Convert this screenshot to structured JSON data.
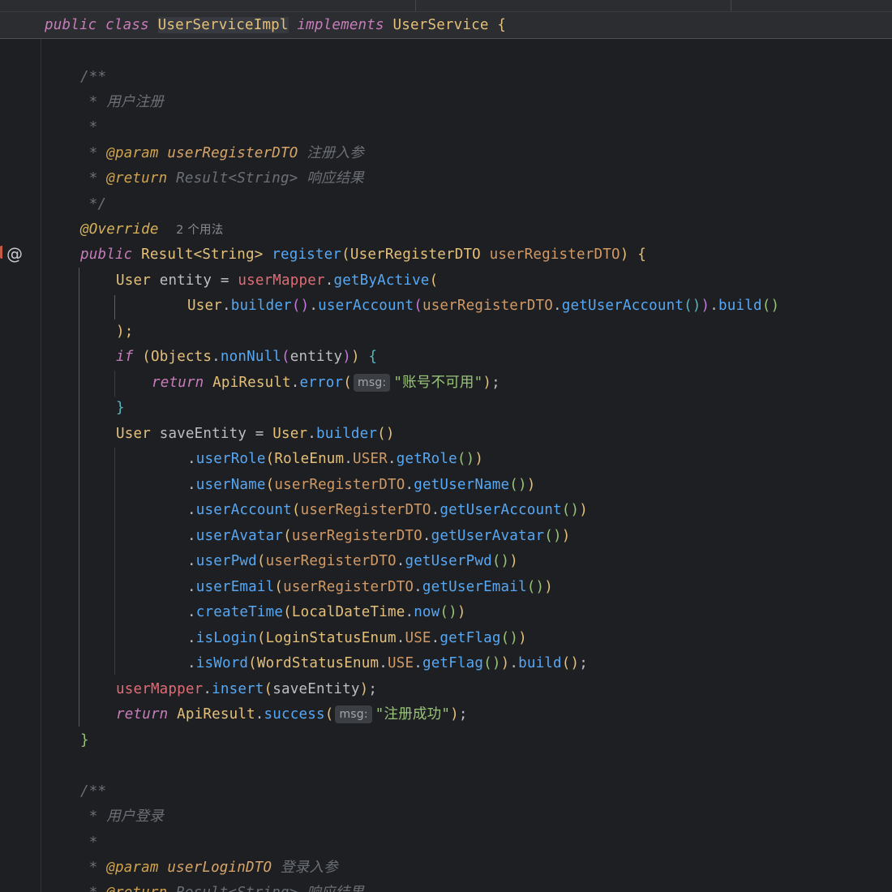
{
  "editor": {
    "header": {
      "kw_public": "public",
      "kw_class": "class",
      "class_name": "UserServiceImpl",
      "kw_implements": "implements",
      "interface_name": "UserService",
      "brace": "{"
    },
    "gutter": {
      "implementation_marker": "@"
    },
    "doc1": {
      "open": "/**",
      "summary": " * 用户注册",
      "blank": " *",
      "param_star": " * ",
      "param_tag": "@param",
      "param_name": "userRegisterDTO",
      "param_desc": "注册入参",
      "return_star": " * ",
      "return_tag": "@return",
      "return_type": "Result<String>",
      "return_desc": "响应结果",
      "close": " */"
    },
    "override": {
      "annotation": "@Override",
      "usages_hint": "2 个用法"
    },
    "method_sig": {
      "kw_public": "public",
      "return_type": "Result<String>",
      "name": "register",
      "param_type": "UserRegisterDTO",
      "param_name": "userRegisterDTO",
      "tail": ") {"
    },
    "stmt_entity": {
      "type": "User",
      "var": "entity",
      "eq": " = ",
      "field": "userMapper",
      "method": "getByActive",
      "open": "("
    },
    "stmt_builder_line": {
      "type": "User",
      "builder": "builder",
      "userAccount": "userAccount",
      "dto": "userRegisterDTO",
      "getter": "getUserAccount",
      "build": "build"
    },
    "stmt_close": ");",
    "if_line": {
      "kw_if": "if",
      "cls": "Objects",
      "method": "nonNull",
      "arg": "entity"
    },
    "return_error": {
      "kw_return": "return",
      "cls": "ApiResult",
      "method": "error",
      "hint": "msg:",
      "string": "\"账号不可用\""
    },
    "close_if": "}",
    "save_entity": {
      "type": "User",
      "var": "saveEntity",
      "eq": " = ",
      "cls": "User",
      "method": "builder"
    },
    "chain": [
      {
        "method": "userRole",
        "arg_cls": "RoleEnum",
        "arg_const": "USER",
        "arg_call": "getRole",
        "style": "enum"
      },
      {
        "method": "userName",
        "arg_cls": "userRegisterDTO",
        "arg_call": "getUserName",
        "style": "dto"
      },
      {
        "method": "userAccount",
        "arg_cls": "userRegisterDTO",
        "arg_call": "getUserAccount",
        "style": "dto"
      },
      {
        "method": "userAvatar",
        "arg_cls": "userRegisterDTO",
        "arg_call": "getUserAvatar",
        "style": "dto"
      },
      {
        "method": "userPwd",
        "arg_cls": "userRegisterDTO",
        "arg_call": "getUserPwd",
        "style": "dto"
      },
      {
        "method": "userEmail",
        "arg_cls": "userRegisterDTO",
        "arg_call": "getUserEmail",
        "style": "dto"
      },
      {
        "method": "createTime",
        "arg_cls": "LocalDateTime",
        "arg_call": "now",
        "style": "static"
      },
      {
        "method": "isLogin",
        "arg_cls": "LoginStatusEnum",
        "arg_const": "USE",
        "arg_call": "getFlag",
        "style": "enum"
      },
      {
        "method": "isWord",
        "arg_cls": "WordStatusEnum",
        "arg_const": "USE",
        "arg_call": "getFlag",
        "style": "enum_build"
      }
    ],
    "insert_line": {
      "field": "userMapper",
      "method": "insert",
      "arg": "saveEntity"
    },
    "return_success": {
      "kw_return": "return",
      "cls": "ApiResult",
      "method": "success",
      "hint": "msg:",
      "string": "\"注册成功\""
    },
    "close_method": "}",
    "doc2": {
      "open": "/**",
      "summary": " * 用户登录",
      "blank": " *",
      "param_star": " * ",
      "param_tag": "@param",
      "param_name": "userLoginDTO",
      "param_desc": "登录入参",
      "return_star": " * ",
      "return_tag": "@return",
      "return_type": "Result<String>",
      "return_desc": "响应结果"
    }
  }
}
